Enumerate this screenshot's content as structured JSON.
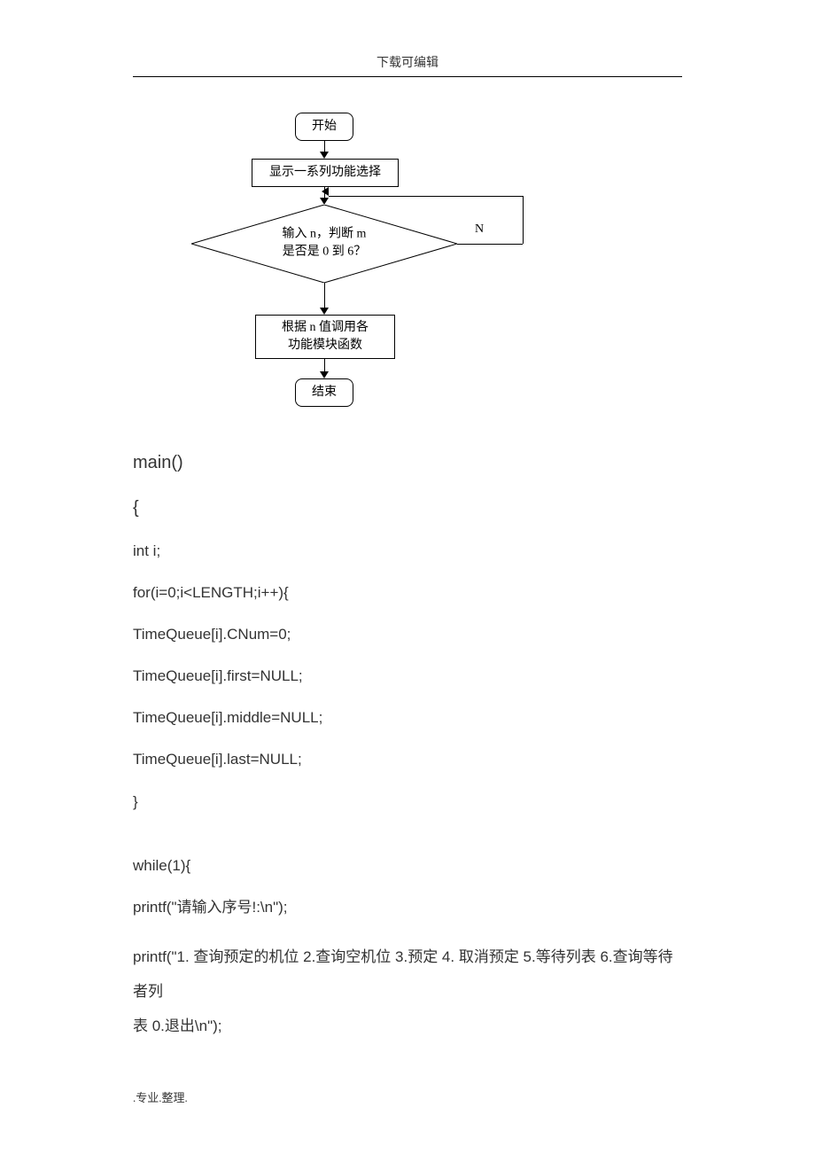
{
  "chart_data": {
    "type": "flowchart",
    "nodes": [
      {
        "id": "start",
        "shape": "terminator",
        "text": "开始"
      },
      {
        "id": "menu",
        "shape": "process",
        "text": "显示一系列功能选择"
      },
      {
        "id": "decision",
        "shape": "decision",
        "text": "输入 n，判断 m\n是否是 0 到 6？"
      },
      {
        "id": "call",
        "shape": "process",
        "text": "根据 n 值调用各\n功能模块函数"
      },
      {
        "id": "end",
        "shape": "terminator",
        "text": "结束"
      }
    ],
    "edges": [
      {
        "from": "start",
        "to": "menu"
      },
      {
        "from": "menu",
        "to": "decision"
      },
      {
        "from": "decision",
        "to": "call",
        "label": ""
      },
      {
        "from": "decision",
        "to": "decision",
        "label": "N",
        "loop": true
      },
      {
        "from": "call",
        "to": "end"
      }
    ]
  },
  "header": {
    "title": "下载可编辑"
  },
  "flow": {
    "start": "开始",
    "menu": "显示一系列功能选择",
    "decision_l1": "输入 n，判断 m",
    "decision_l2": "是否是 0 到 6？",
    "branch_n": "N",
    "call_l1": "根据 n 值调用各",
    "call_l2": "功能模块函数",
    "end": "结束"
  },
  "code": {
    "l1": "main()",
    "l2": "{",
    "l3": "int i;",
    "l4": "for(i=0;i<LENGTH;i++){",
    "l5": "TimeQueue[i].CNum=0;",
    "l6": "TimeQueue[i].first=NULL;",
    "l7": "TimeQueue[i].middle=NULL;",
    "l8": "TimeQueue[i].last=NULL;",
    "l9": "}",
    "l10": "while(1){",
    "l11": "printf(\"请输入序号!:\\n\");",
    "l12": "printf(\"1. 查询预定的机位  2.查询空机位  3.预定  4. 取消预定  5.等待列表  6.查询等待者列",
    "l13": "表  0.退出\\n\");"
  },
  "footer": {
    "text": ".专业.整理."
  }
}
